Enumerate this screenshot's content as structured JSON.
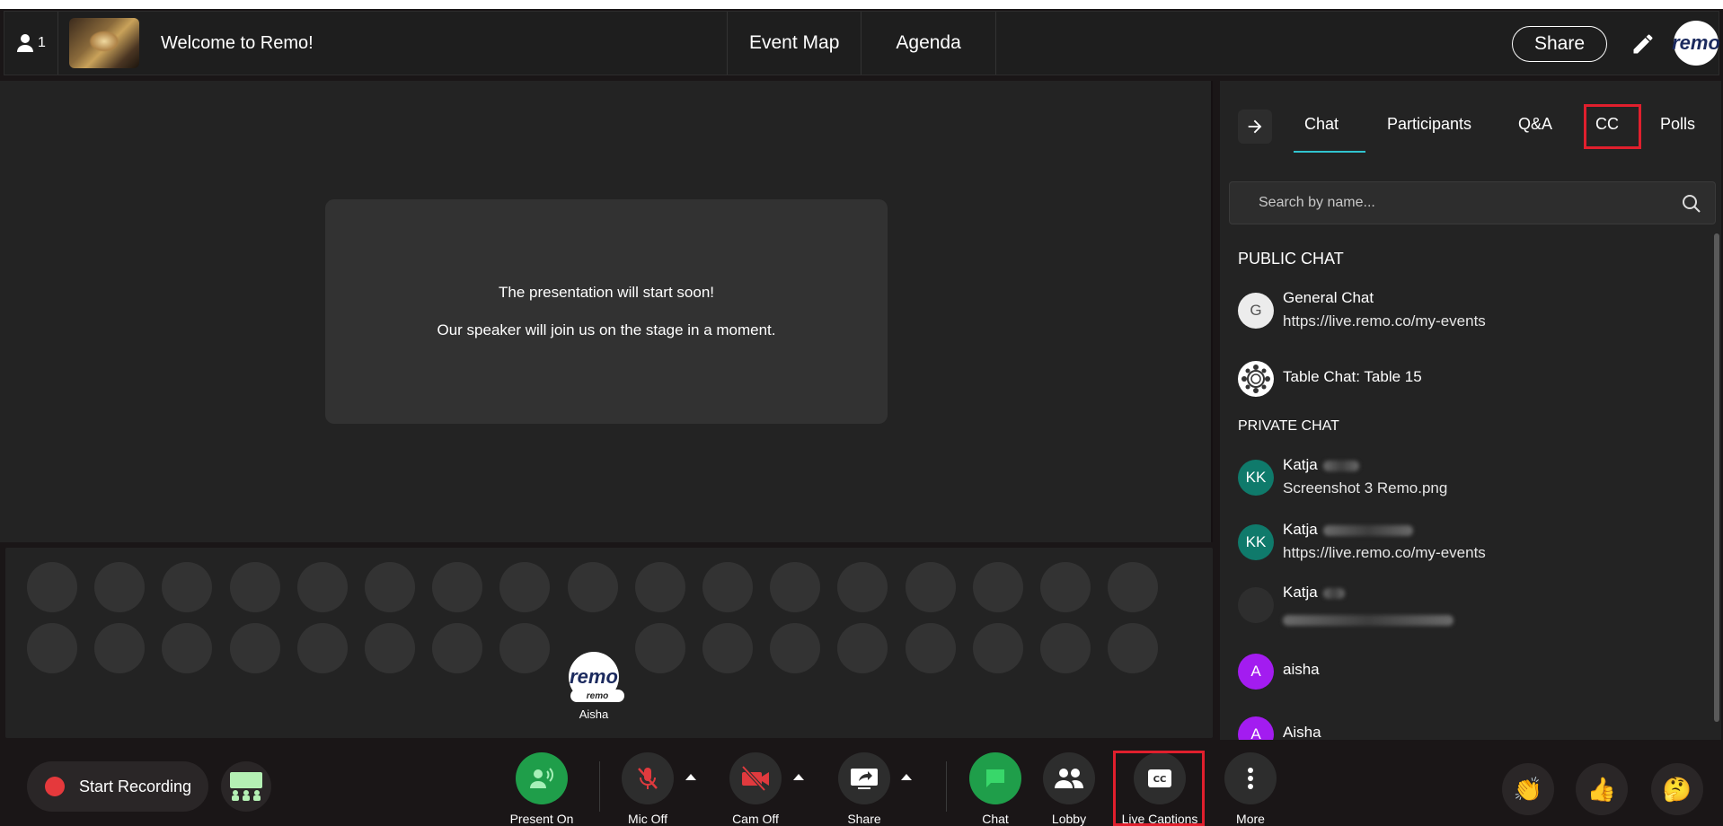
{
  "header": {
    "participant_count": "1",
    "welcome_title": "Welcome to Remo!",
    "nav": [
      "Event Map",
      "Agenda"
    ],
    "share_label": "Share",
    "avatar_text": "remo"
  },
  "stage": {
    "line1": "The presentation will start soon!",
    "line2": "Our speaker will join us on the stage in a moment."
  },
  "seats": {
    "user_name": "Aisha",
    "user_avatar_text": "remo",
    "user_tag": "remo"
  },
  "panel": {
    "tabs": [
      "Chat",
      "Participants",
      "Q&A",
      "CC",
      "Polls"
    ],
    "active_tab": "Chat",
    "search_placeholder": "Search by name...",
    "public_heading": "PUBLIC CHAT",
    "private_heading": "PRIVATE CHAT",
    "public_chats": [
      {
        "avatar": "G",
        "title": "General Chat",
        "subtitle": "https://live.remo.co/my-events"
      },
      {
        "avatar": "",
        "title": "Table Chat: Table 15",
        "subtitle": ""
      }
    ],
    "private_chats": [
      {
        "avatar": "KK",
        "title": "Katja",
        "subtitle": "Screenshot 3 Remo.png"
      },
      {
        "avatar": "KK",
        "title": "Katja",
        "subtitle": "https://live.remo.co/my-events"
      },
      {
        "avatar": "",
        "title": "Katja",
        "subtitle": ""
      },
      {
        "avatar": "A",
        "title": "aisha",
        "subtitle": ""
      },
      {
        "avatar": "A",
        "title": "Aisha",
        "subtitle": ""
      }
    ],
    "colors": {
      "teal": "#0f7a6b",
      "purple": "#a31cf0",
      "accent": "#31c4cf",
      "highlight": "#e01f2d"
    }
  },
  "controls": {
    "start_recording": "Start Recording",
    "present_on": "Present On",
    "mic_off": "Mic Off",
    "cam_off": "Cam Off",
    "share": "Share",
    "chat": "Chat",
    "lobby": "Lobby",
    "live_captions": "Live Captions",
    "more": "More"
  }
}
